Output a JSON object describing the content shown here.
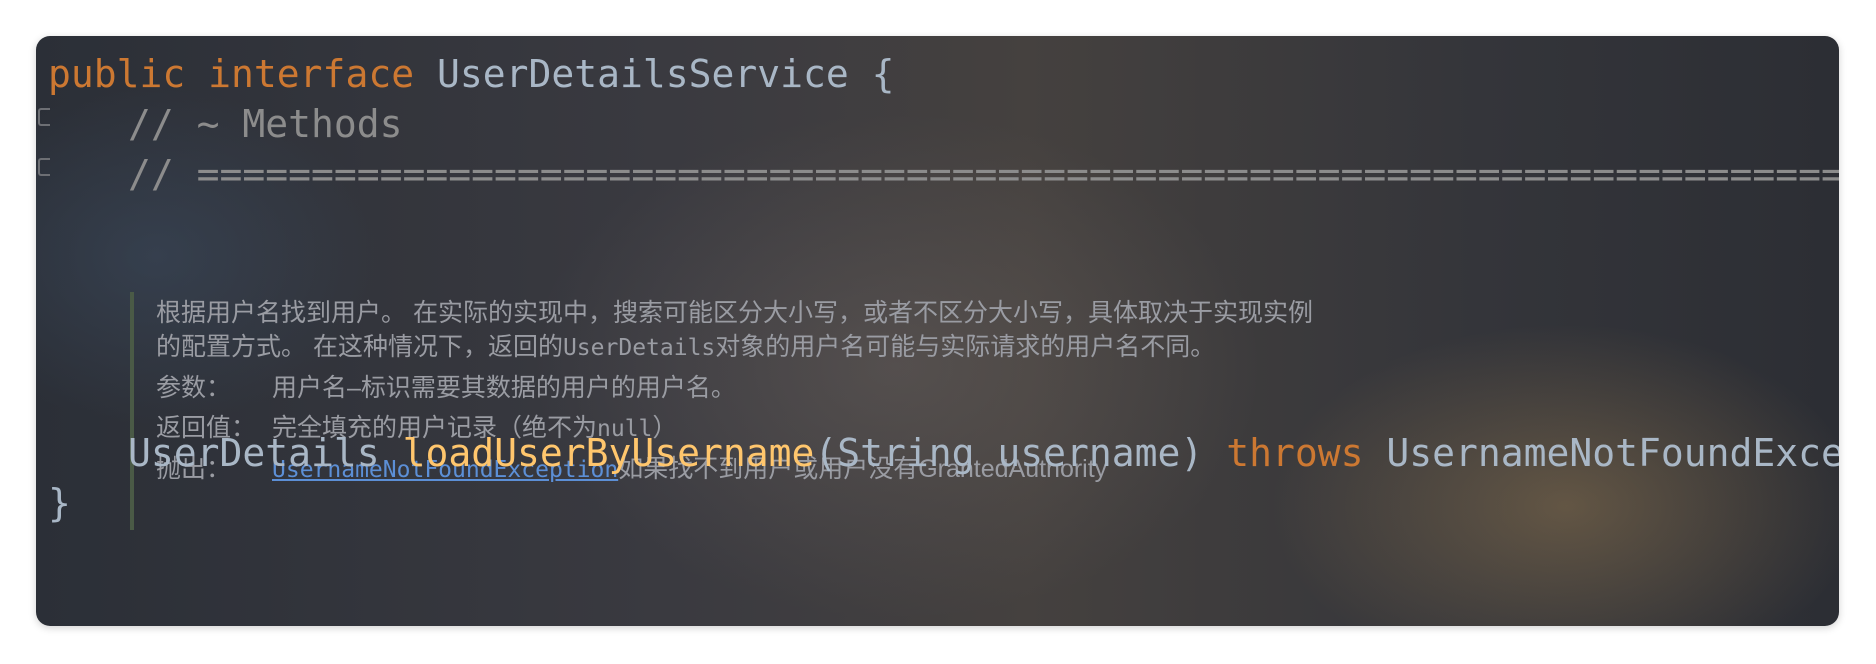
{
  "code": {
    "line1": {
      "kw_public": "public",
      "kw_interface": "interface",
      "name": "UserDetailsService",
      "brace": "{"
    },
    "comment_methods": "// ~ Methods",
    "comment_rule": "// ========================================================================================================",
    "method": {
      "return_type": "UserDetails",
      "name": "loadUserByUsername",
      "params": "(String username)",
      "kw_throws": "throws",
      "exception": "UsernameNotFoundException",
      "semicolon": ";"
    },
    "close_brace": "}"
  },
  "doc": {
    "desc_line1": "根据用户名找到用户。 在实际的实现中，搜索可能区分大小写，或者不区分大小写，具体取决于实现实例",
    "desc_line2_a": "的配置方式。 在这种情况下，返回的",
    "desc_line2_code": "UserDetails",
    "desc_line2_b": "对象的用户名可能与实际请求的用户名不同。",
    "params_label": "参数：",
    "params_value": "用户名–标识需要其数据的用户的用户名。",
    "returns_label": "返回值：",
    "returns_value_a": "完全填充的用户记录（绝不为",
    "returns_value_code": "null",
    "returns_value_b": "）",
    "throws_label": "抛出：",
    "throws_link": "UsernameNotFoundException",
    "throws_value": "如果找不到用户或用户没有GrantedAuthority"
  },
  "colors": {
    "keyword": "#cc7832",
    "function": "#ffc66d",
    "identifier": "#a9b7c6",
    "comment": "#8c8c8c",
    "link": "#5c8fd6"
  }
}
